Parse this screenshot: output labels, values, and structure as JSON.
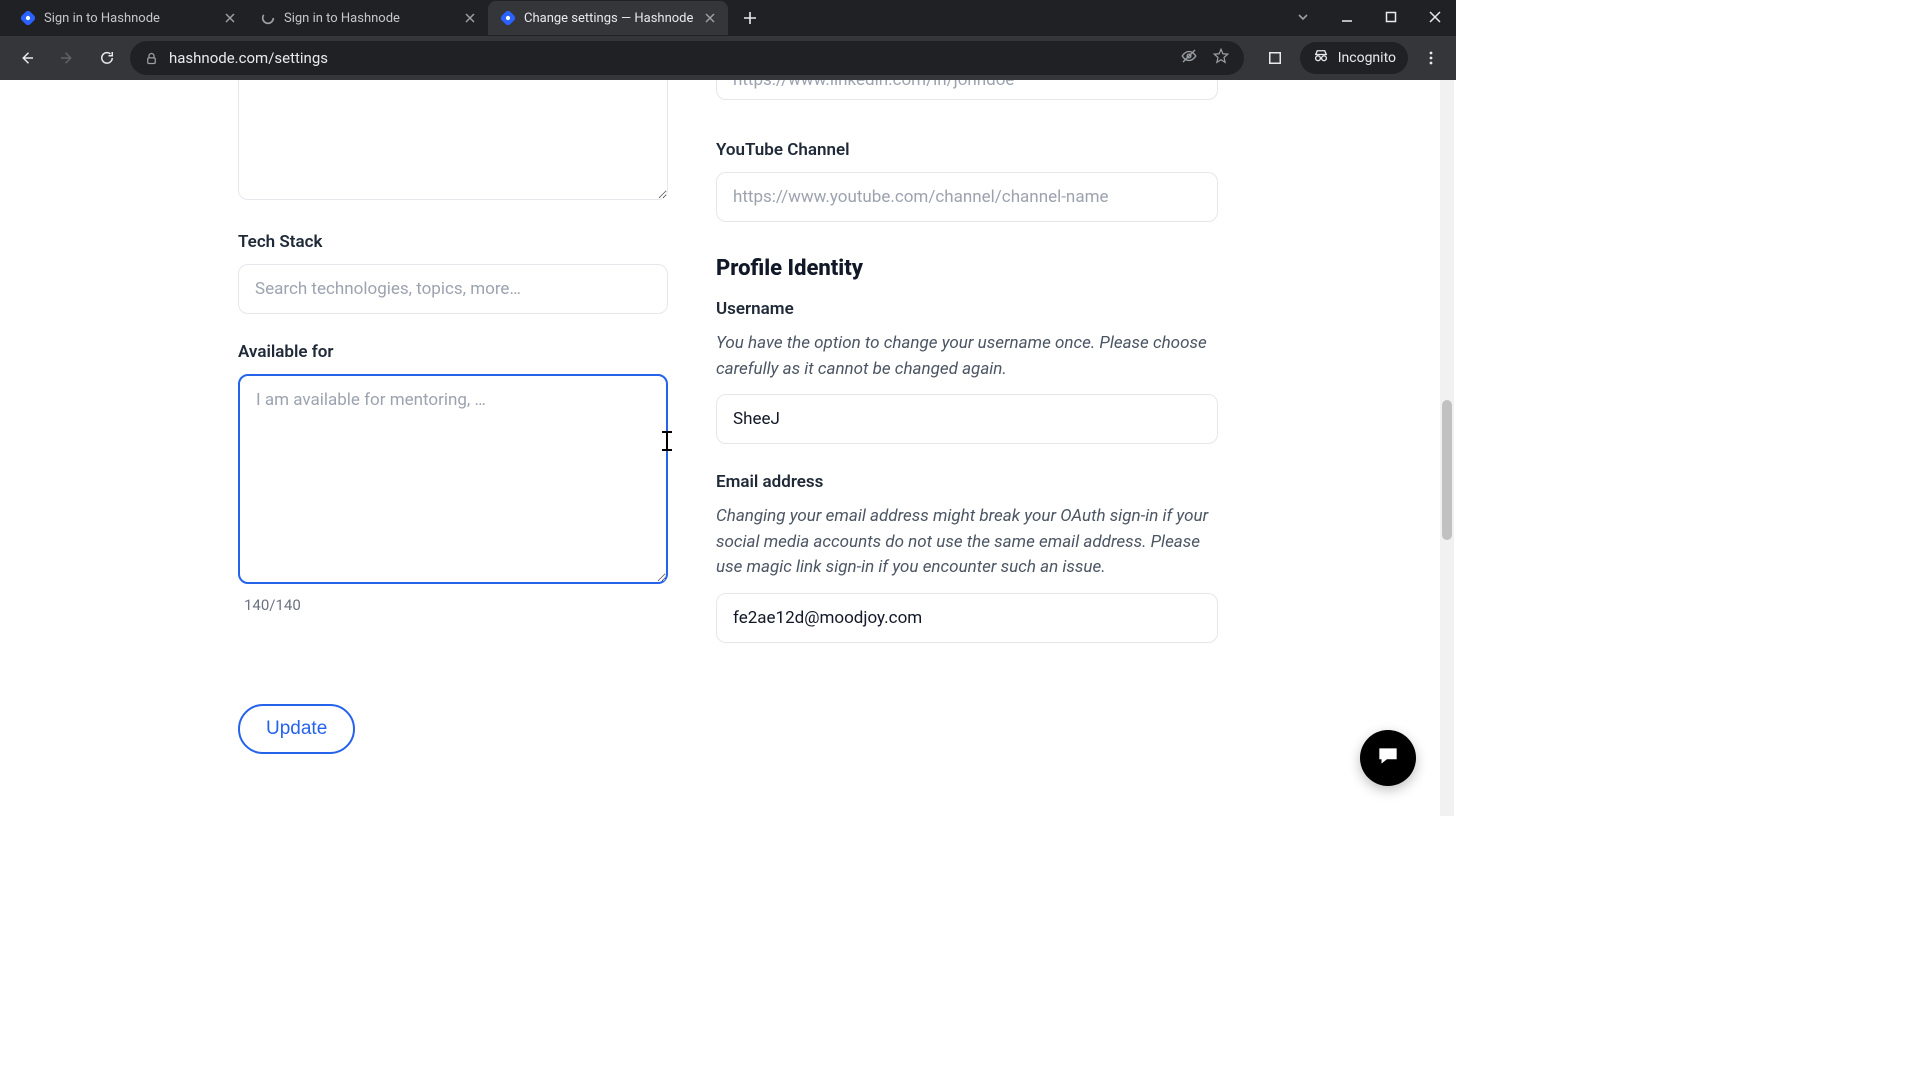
{
  "browser": {
    "tabs": [
      {
        "title": "Sign in to Hashnode",
        "active": false,
        "favicon": "hashnode"
      },
      {
        "title": "Sign in to Hashnode",
        "active": false,
        "favicon": "spinner"
      },
      {
        "title": "Change settings — Hashnode",
        "active": true,
        "favicon": "hashnode"
      }
    ],
    "url": "hashnode.com/settings",
    "incognito_label": "Incognito"
  },
  "left": {
    "tech_stack_label": "Tech Stack",
    "tech_stack_placeholder": "Search technologies, topics, more…",
    "available_for_label": "Available for",
    "available_for_placeholder": "I am available for mentoring, …",
    "available_for_value": "",
    "char_count": "140/140",
    "update_label": "Update"
  },
  "right": {
    "linkedin_placeholder": "https://www.linkedin.com/in/johndoe",
    "youtube_label": "YouTube Channel",
    "youtube_placeholder": "https://www.youtube.com/channel/channel-name",
    "identity_title": "Profile Identity",
    "username_label": "Username",
    "username_note": "You have the option to change your username once. Please choose carefully as it cannot be changed again.",
    "username_value": "SheeJ",
    "email_label": "Email address",
    "email_note": "Changing your email address might break your OAuth sign-in if your social media accounts do not use the same email address. Please use magic link sign-in if you encounter such an issue.",
    "email_value": "fe2ae12d@moodjoy.com"
  }
}
